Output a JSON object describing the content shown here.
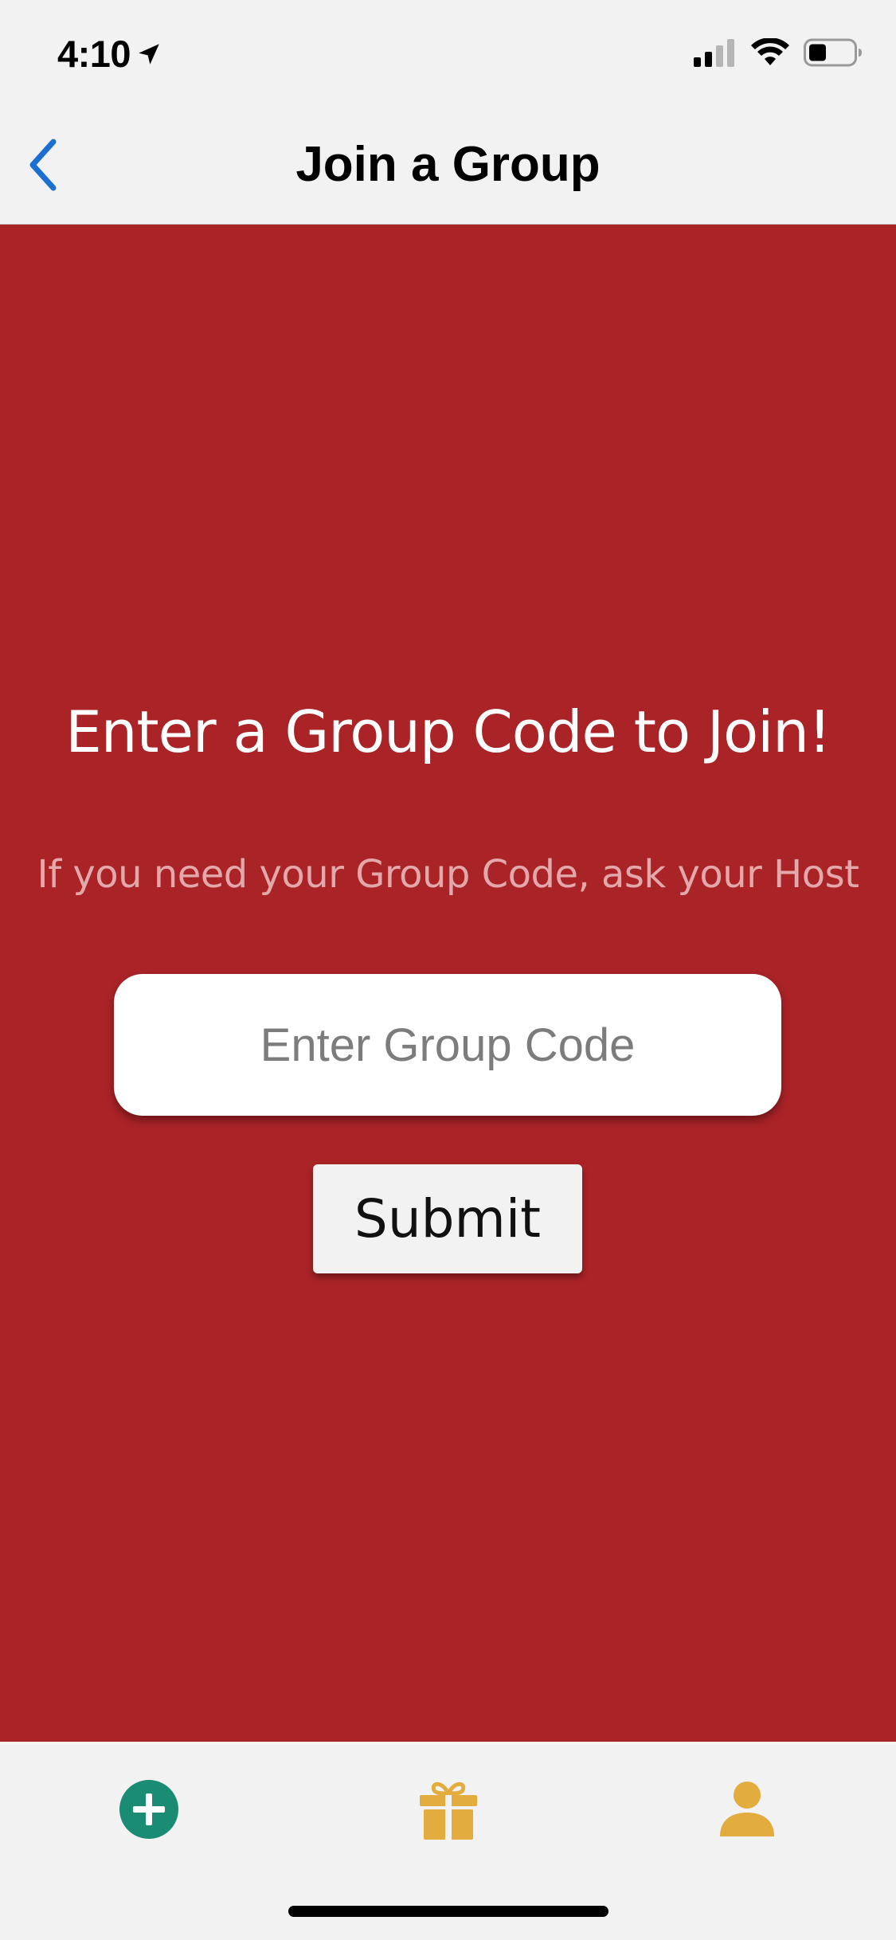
{
  "status_bar": {
    "time": "4:10",
    "location_icon": "location-arrow-icon",
    "signal_icon": "cellular-signal-icon",
    "wifi_icon": "wifi-icon",
    "battery_icon": "battery-icon"
  },
  "nav": {
    "title": "Join a Group",
    "back_icon": "chevron-left-icon"
  },
  "main": {
    "headline": "Enter a Group Code to Join!",
    "subtext": "If you need your Group Code, ask your Host",
    "input_placeholder": "Enter Group Code",
    "input_value": "",
    "submit_label": "Submit"
  },
  "tab_bar": {
    "tabs": [
      {
        "icon": "plus-circle-icon",
        "color": "#1a8c74"
      },
      {
        "icon": "gift-icon",
        "color": "#e3ac3e"
      },
      {
        "icon": "person-icon",
        "color": "#e3ac3e"
      }
    ]
  },
  "colors": {
    "background_red": "#a92327",
    "accent_blue": "#1a6fd1",
    "accent_green": "#1a8c74",
    "accent_gold": "#e3ac3e"
  }
}
